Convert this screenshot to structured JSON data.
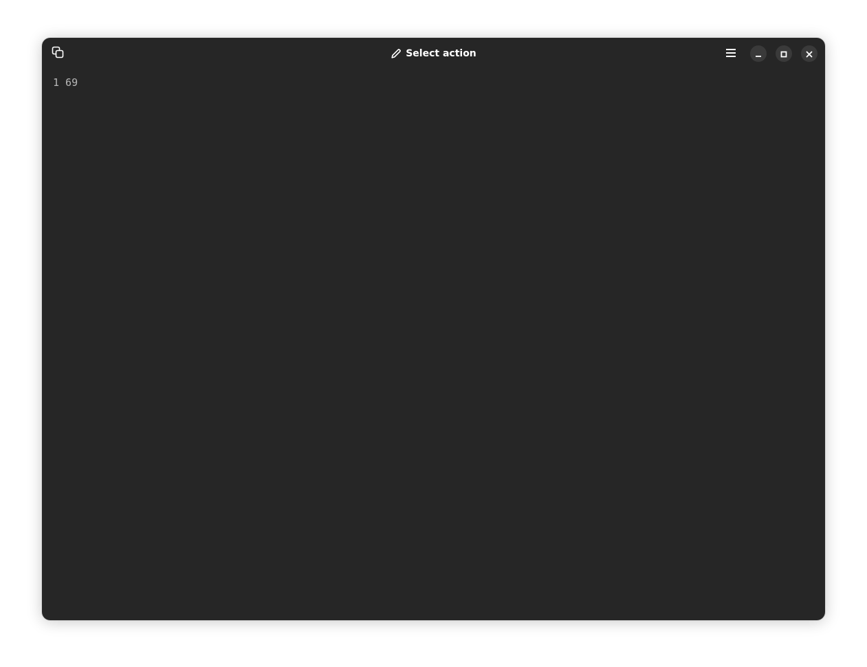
{
  "window": {
    "title": "Select action",
    "title_icon": "pencil-icon"
  },
  "headerbar": {
    "left_icon": "copy-icon",
    "menu_icon": "hamburger-menu-icon",
    "controls": [
      "minimize-icon",
      "maximize-icon",
      "close-icon"
    ]
  },
  "terminal": {
    "output": "1 69"
  },
  "colors": {
    "window_bg": "#262626",
    "control_bg": "#3a3a3a",
    "text": "#b8b8b8",
    "title_text": "#ffffff"
  }
}
